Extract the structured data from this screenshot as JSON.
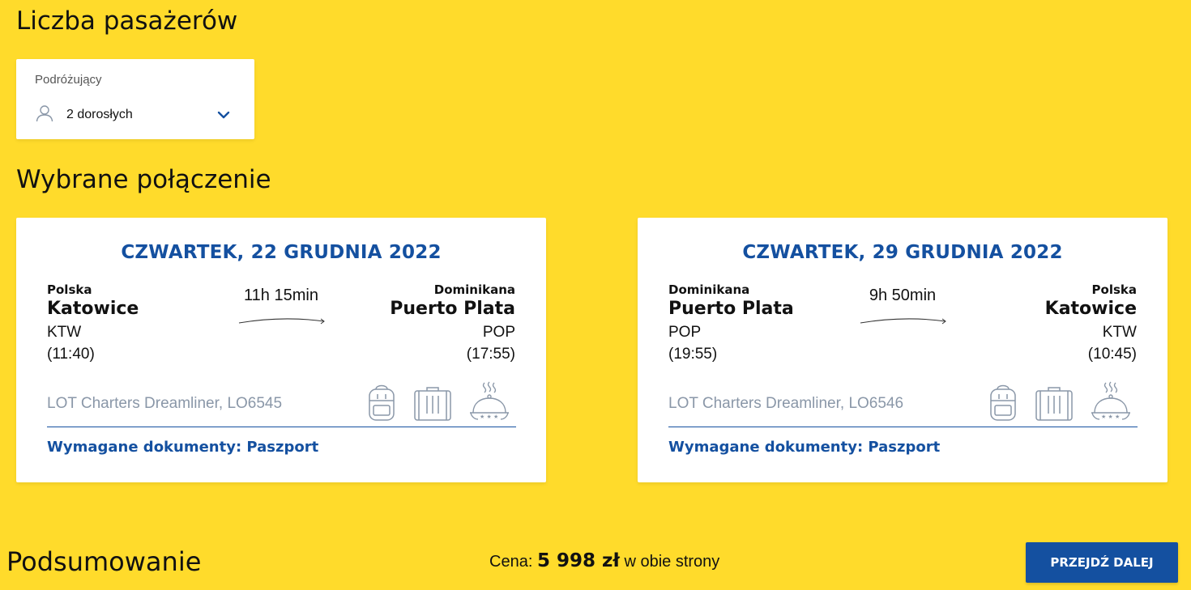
{
  "passengers": {
    "title": "Liczba pasażerów",
    "label": "Podróżujący",
    "value": "2 dorosłych"
  },
  "connection": {
    "title": "Wybrane połączenie",
    "flights": [
      {
        "date": "CZWARTEK, 22 GRUDNIA 2022",
        "origin": {
          "country": "Polska",
          "city": "Katowice",
          "code": "KTW",
          "time": "(11:40)"
        },
        "destination": {
          "country": "Dominikana",
          "city": "Puerto Plata",
          "code": "POP",
          "time": "(17:55)"
        },
        "duration": "11h 15min",
        "carrier": "LOT Charters Dreamliner, LO6545",
        "documents": "Wymagane dokumenty: Paszport",
        "amenities": [
          "backpack-icon",
          "luggage-icon",
          "meal-icon"
        ]
      },
      {
        "date": "CZWARTEK, 29 GRUDNIA 2022",
        "origin": {
          "country": "Dominikana",
          "city": "Puerto Plata",
          "code": "POP",
          "time": "(19:55)"
        },
        "destination": {
          "country": "Polska",
          "city": "Katowice",
          "code": "KTW",
          "time": "(10:45)"
        },
        "duration": "9h 50min",
        "carrier": "LOT Charters Dreamliner, LO6546",
        "documents": "Wymagane dokumenty: Paszport",
        "amenities": [
          "backpack-icon",
          "luggage-icon",
          "meal-icon"
        ]
      }
    ]
  },
  "summary": {
    "title": "Podsumowanie",
    "price_label": "Cena:",
    "price_amount": "5 998 zł",
    "price_suffix": "w obie strony",
    "next_button": "PRZEJDŹ DALEJ"
  },
  "colors": {
    "background": "#FFDB2B",
    "brand_blue": "#1450A0",
    "muted_text": "#8A97A8"
  }
}
